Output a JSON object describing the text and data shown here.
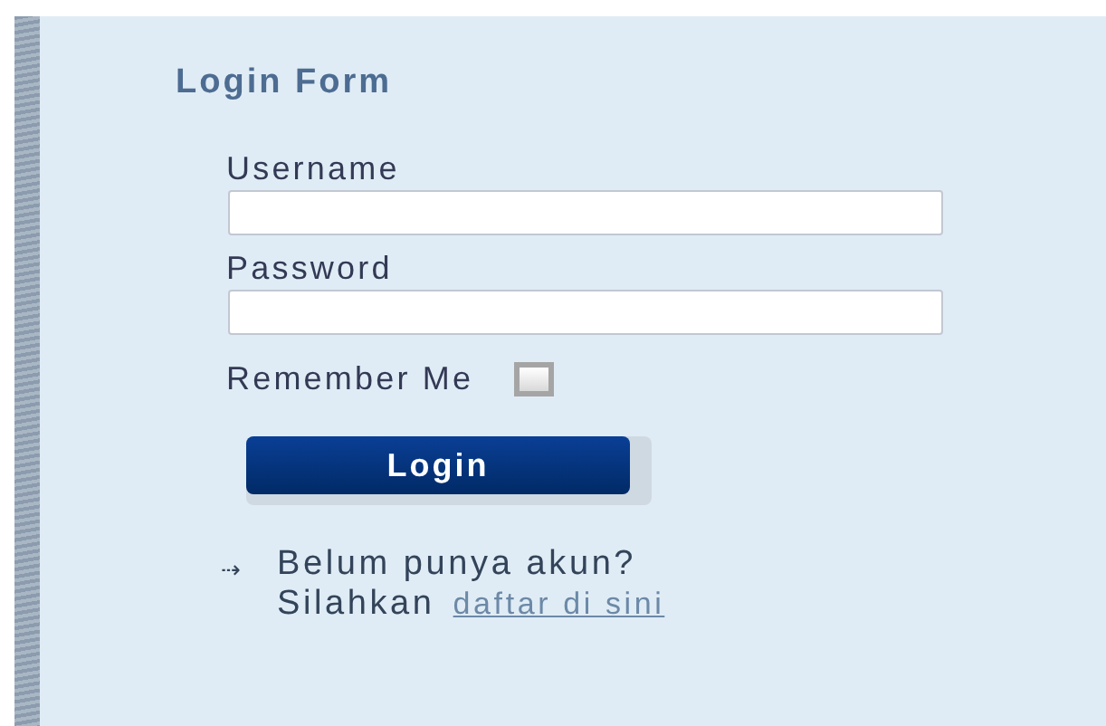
{
  "form": {
    "title": "Login Form",
    "fields": [
      {
        "label": "Username"
      },
      {
        "label": "Password"
      }
    ],
    "remember": {
      "label": "Remember Me",
      "checked": false
    },
    "submit": "Login",
    "signup": {
      "arrow": "⇢",
      "question": "Belum punya akun?",
      "prompt": "Silahkan",
      "link": "daftar di sini"
    }
  }
}
